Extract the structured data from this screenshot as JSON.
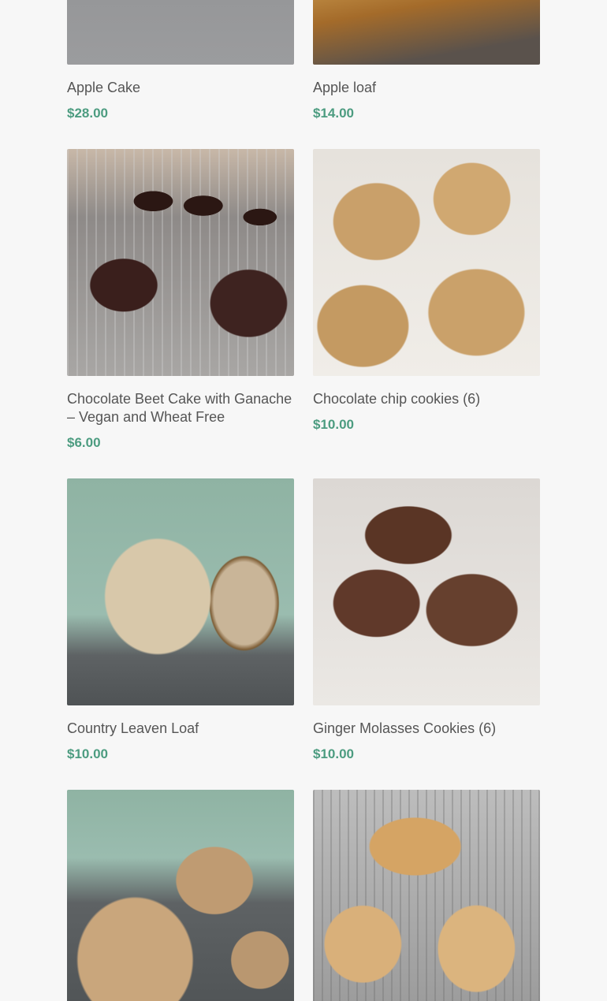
{
  "products": [
    {
      "name": "Apple Cake",
      "price": "$28.00",
      "image": "apple-cake"
    },
    {
      "name": "Apple loaf",
      "price": "$14.00",
      "image": "apple-loaf"
    },
    {
      "name": "Chocolate Beet Cake with Ganache – Vegan and Wheat Free",
      "price": "$6.00",
      "image": "chocolate-beet-cake"
    },
    {
      "name": "Chocolate chip cookies (6)",
      "price": "$10.00",
      "image": "chocolate-chip-cookies"
    },
    {
      "name": "Country Leaven Loaf",
      "price": "$10.00",
      "image": "country-leaven-loaf"
    },
    {
      "name": "Ginger Molasses Cookies (6)",
      "price": "$10.00",
      "image": "ginger-molasses-cookies"
    },
    {
      "name": "",
      "price": "",
      "image": "bread-loaves"
    },
    {
      "name": "",
      "price": "",
      "image": "apple-galettes"
    }
  ],
  "colors": {
    "background": "#f7f7f7",
    "title": "#555555",
    "price": "#4c9c80"
  }
}
